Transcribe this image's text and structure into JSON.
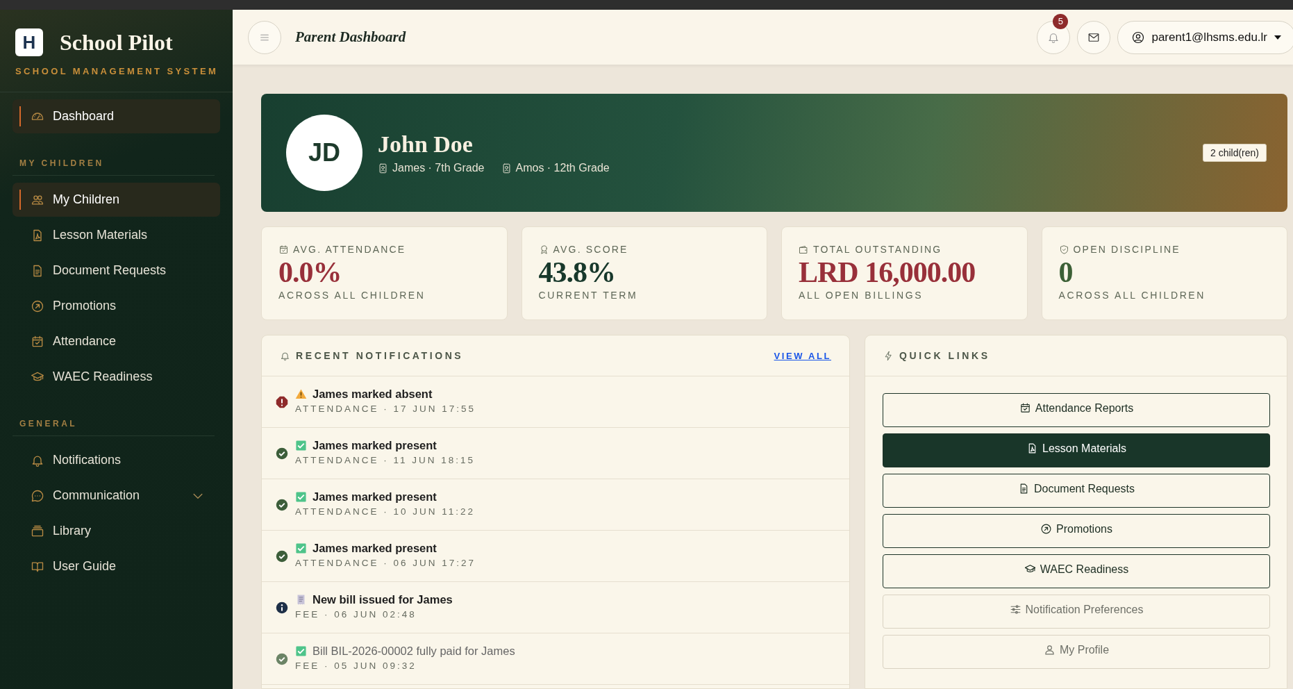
{
  "sidebar": {
    "brand": {
      "logo_letter": "H",
      "title": "School Pilot",
      "subtitle": "SCHOOL MANAGEMENT SYSTEM"
    },
    "sections": [
      {
        "items": [
          {
            "label": "Dashboard",
            "selected": true
          }
        ]
      },
      {
        "title": "MY CHILDREN",
        "items": [
          {
            "label": "My Children",
            "selected": true
          },
          {
            "label": "Lesson Materials",
            "selected": false
          },
          {
            "label": "Document Requests",
            "selected": false
          },
          {
            "label": "Promotions",
            "selected": false
          },
          {
            "label": "Attendance",
            "selected": false
          },
          {
            "label": "WAEC Readiness",
            "selected": false
          }
        ]
      },
      {
        "title": "GENERAL",
        "items": [
          {
            "label": "Notifications",
            "selected": false
          },
          {
            "label": "Communication",
            "selected": false,
            "expanded": false
          },
          {
            "label": "Library",
            "selected": false
          },
          {
            "label": "User Guide",
            "selected": false
          }
        ]
      }
    ]
  },
  "header": {
    "title": "Parent Dashboard",
    "notification_count": "5",
    "user": "parent1@lhsms.edu.lr"
  },
  "profile": {
    "initials": "JD",
    "name": "John Doe",
    "children": [
      "James · 7th Grade",
      "Amos · 12th Grade"
    ],
    "badge": "2 child(ren)"
  },
  "stats": [
    {
      "label": "AVG. ATTENDANCE",
      "value": "0.0%",
      "caption": "ACROSS ALL CHILDREN",
      "kind": "danger"
    },
    {
      "label": "AVG. SCORE",
      "value": "43.8%",
      "caption": "CURRENT TERM",
      "kind": "primary"
    },
    {
      "label": "TOTAL OUTSTANDING",
      "value": "LRD 16,000.00",
      "caption": "ALL OPEN BILLINGS",
      "kind": "danger"
    },
    {
      "label": "OPEN DISCIPLINE",
      "value": "0",
      "caption": "ACROSS ALL CHILDREN",
      "kind": "success"
    }
  ],
  "notifications": {
    "title": "RECENT NOTIFICATIONS",
    "view_all": "VIEW ALL",
    "items": [
      {
        "kind": "error",
        "title": "James marked absent",
        "meta": "ATTENDANCE · 17 JUN 17:55",
        "read": false
      },
      {
        "kind": "success",
        "title": "James marked present",
        "meta": "ATTENDANCE · 11 JUN 18:15",
        "read": false
      },
      {
        "kind": "success",
        "title": "James marked present",
        "meta": "ATTENDANCE · 10 JUN 11:22",
        "read": false
      },
      {
        "kind": "success",
        "title": "James marked present",
        "meta": "ATTENDANCE · 06 JUN 17:27",
        "read": false
      },
      {
        "kind": "info",
        "title": "New bill issued for James",
        "meta": "FEE · 06 JUN 02:48",
        "read": false
      },
      {
        "kind": "success",
        "title": "Bill BIL-2026-00002 fully paid for James",
        "meta": "FEE · 05 JUN 09:32",
        "read": true
      }
    ]
  },
  "quick_links": {
    "title": "QUICK LINKS",
    "items": [
      {
        "label": "Attendance Reports",
        "kind": "outline"
      },
      {
        "label": "Lesson Materials",
        "kind": "filled"
      },
      {
        "label": "Document Requests",
        "kind": "outline"
      },
      {
        "label": "Promotions",
        "kind": "outline"
      },
      {
        "label": "WAEC Readiness",
        "kind": "outline"
      },
      {
        "label": "Notification Preferences",
        "kind": "muted"
      },
      {
        "label": "My Profile",
        "kind": "muted"
      }
    ]
  }
}
